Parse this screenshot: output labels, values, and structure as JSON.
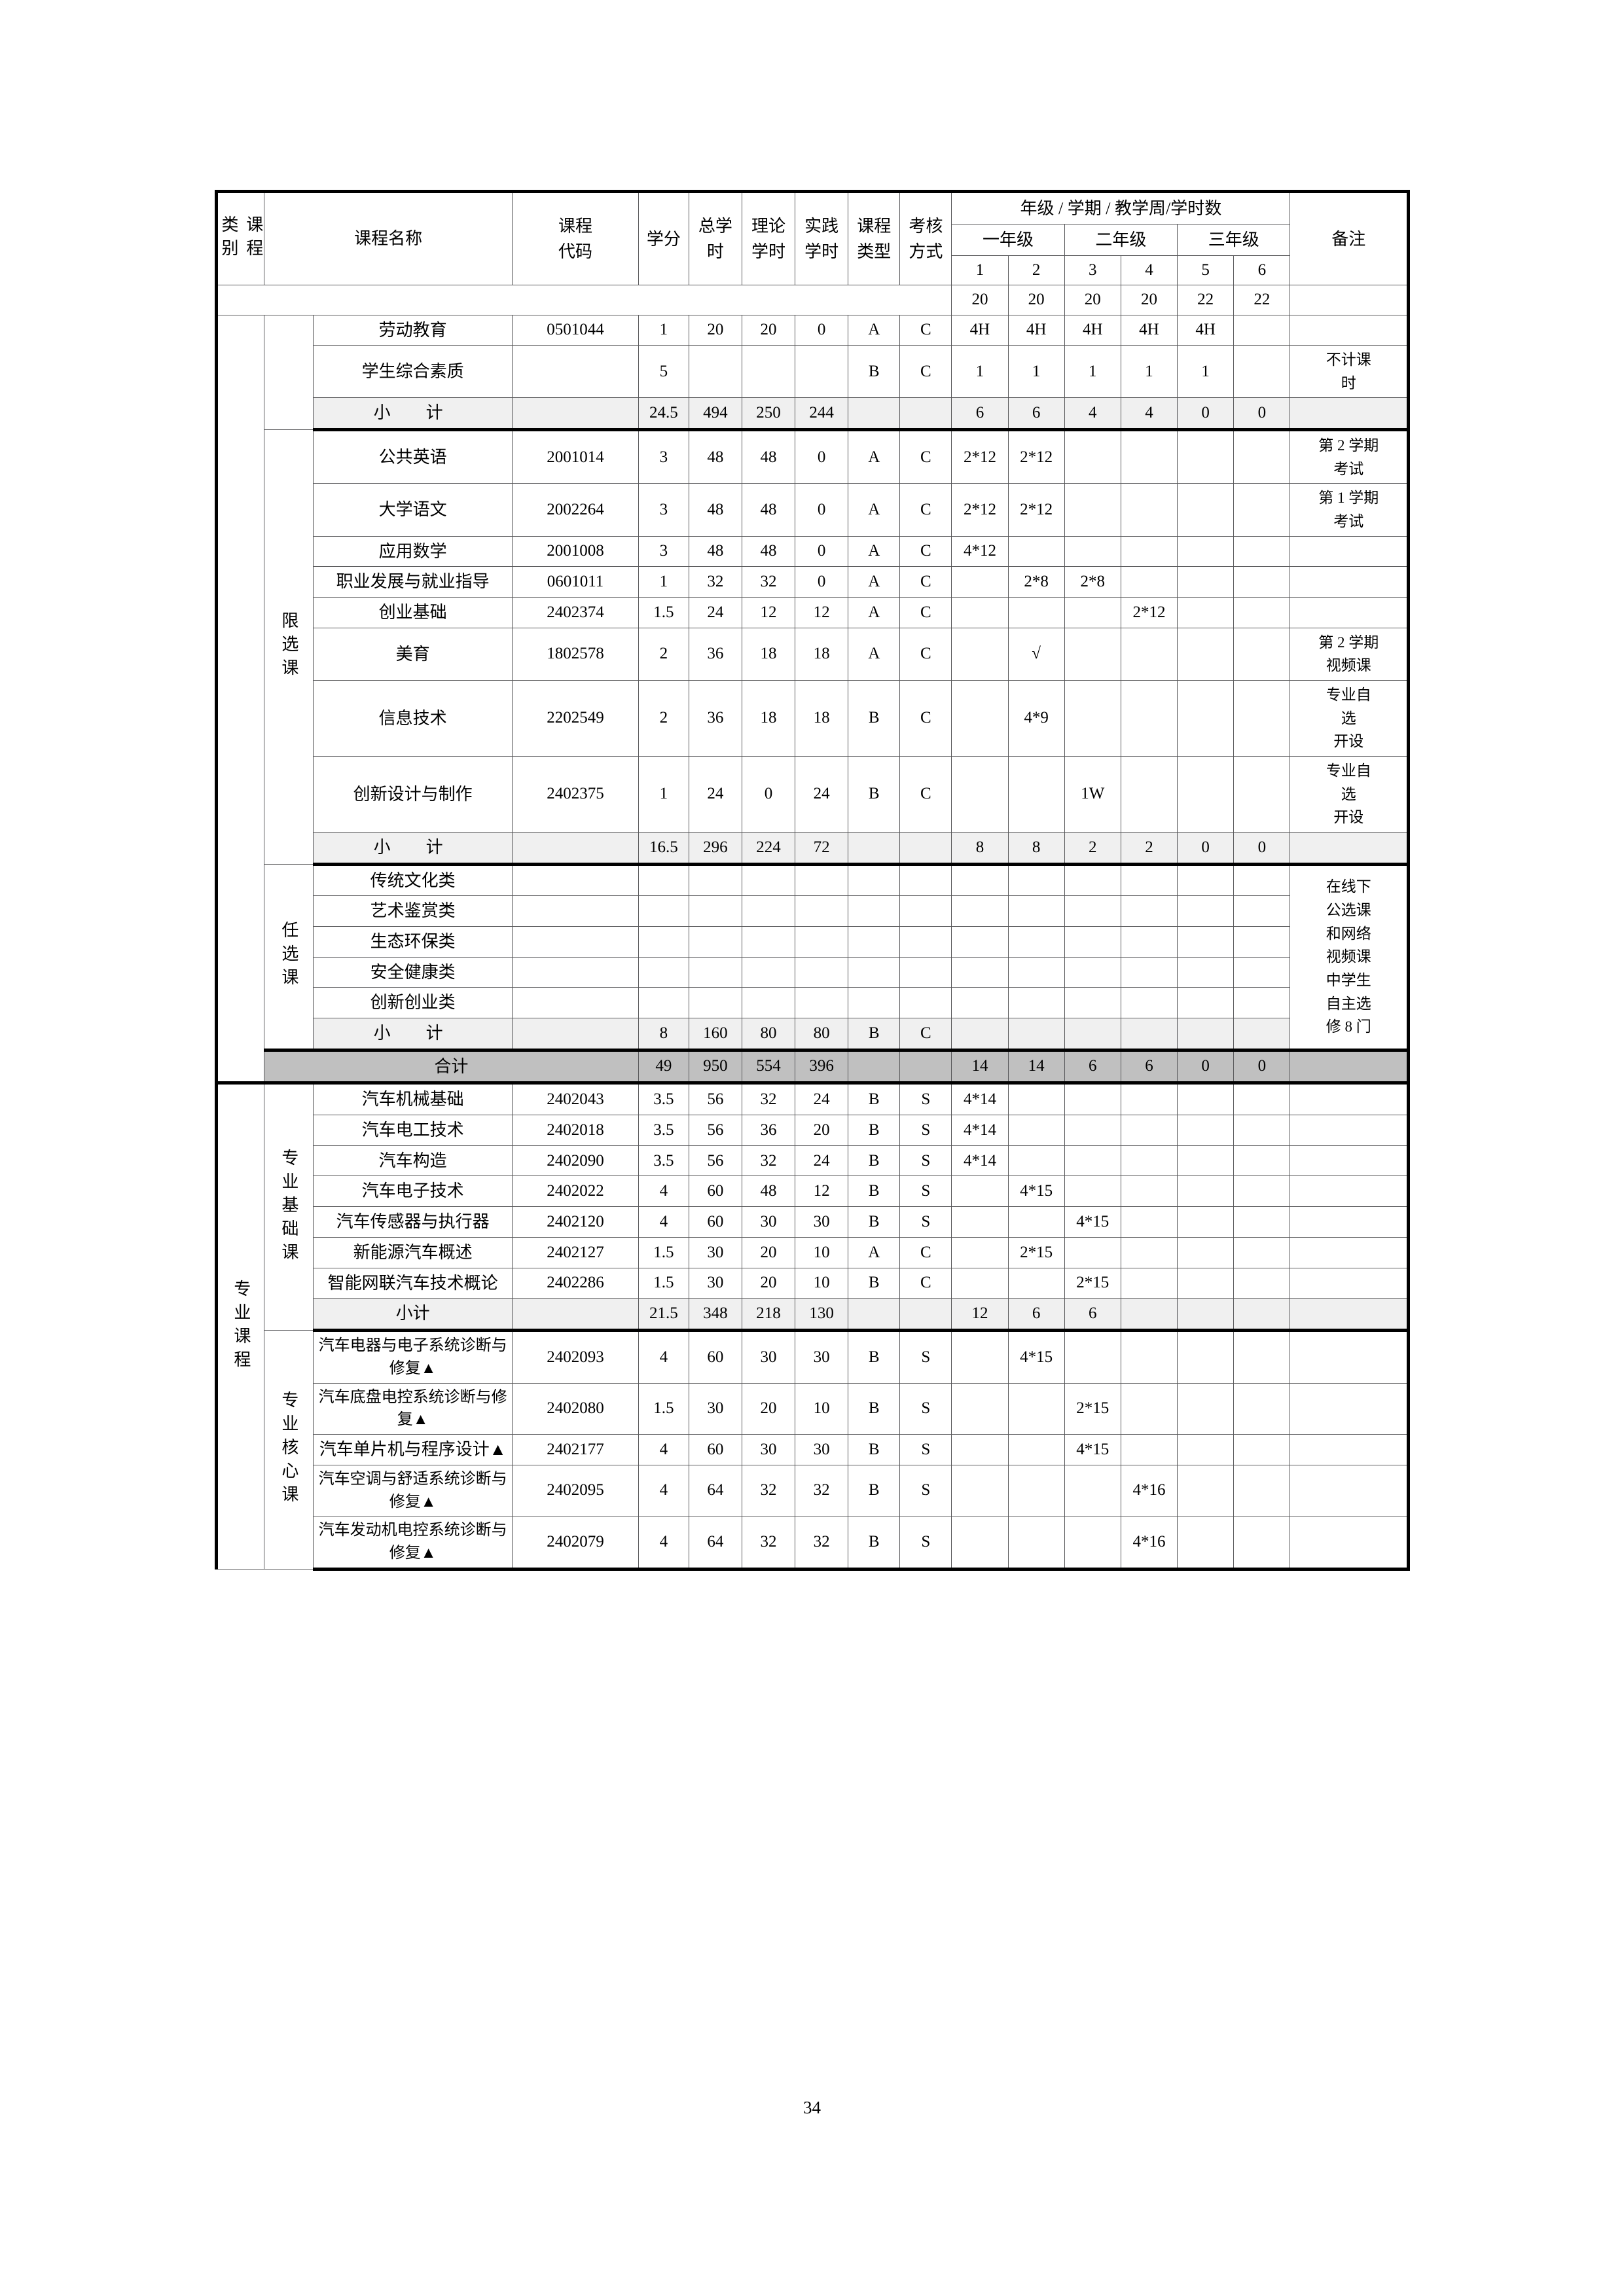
{
  "page": {
    "number": "34"
  },
  "table": {
    "headers": {
      "category": "课程\n类别",
      "course_name": "课程名称",
      "course_code": "课程\n代码",
      "credit": "学分",
      "total_hours": "总学\n时",
      "theory_hours": "理论\n学时",
      "practice_hours": "实践\n学时",
      "course_type": "课程\n类型",
      "exam_method": "考核\n方式",
      "semester_group": "年级 / 学期 / 教学周/学时数",
      "remark": "备注",
      "years": [
        "一年级",
        "二年级",
        "三年级"
      ],
      "semesters": [
        "1",
        "2",
        "3",
        "4",
        "5",
        "6"
      ],
      "weeks": [
        "20",
        "20",
        "20",
        "20",
        "22",
        "22"
      ]
    },
    "sections": [
      {
        "id": "public-required",
        "category_label": "",
        "rows": [
          {
            "name": "劳动教育",
            "code": "0501044",
            "credit": "1",
            "total": "20",
            "theory": "20",
            "practice": "0",
            "type": "A",
            "exam": "C",
            "sem": [
              "4H",
              "4H",
              "4H",
              "4H",
              "4H",
              ""
            ],
            "remark": ""
          },
          {
            "name": "学生综合素质",
            "code": "",
            "credit": "5",
            "total": "",
            "theory": "",
            "practice": "",
            "type": "B",
            "exam": "C",
            "sem": [
              "1",
              "1",
              "1",
              "1",
              "1",
              ""
            ],
            "remark": "不计课\n时"
          }
        ],
        "subtotal": {
          "label": "小　计",
          "code": "",
          "credit": "24.5",
          "total": "494",
          "theory": "250",
          "practice": "244",
          "type": "",
          "exam": "",
          "sem": [
            "6",
            "6",
            "4",
            "4",
            "0",
            "0"
          ],
          "remark": ""
        }
      },
      {
        "id": "restricted-elective",
        "category_label": "限选课",
        "rows": [
          {
            "name": "公共英语",
            "code": "2001014",
            "credit": "3",
            "total": "48",
            "theory": "48",
            "practice": "0",
            "type": "A",
            "exam": "C",
            "sem": [
              "2*12",
              "2*12",
              "",
              "",
              "",
              ""
            ],
            "remark": "第 2 学期\n考试"
          },
          {
            "name": "大学语文",
            "code": "2002264",
            "credit": "3",
            "total": "48",
            "theory": "48",
            "practice": "0",
            "type": "A",
            "exam": "C",
            "sem": [
              "2*12",
              "2*12",
              "",
              "",
              "",
              ""
            ],
            "remark": "第 1 学期\n考试"
          },
          {
            "name": "应用数学",
            "code": "2001008",
            "credit": "3",
            "total": "48",
            "theory": "48",
            "practice": "0",
            "type": "A",
            "exam": "C",
            "sem": [
              "4*12",
              "",
              "",
              "",
              "",
              ""
            ],
            "remark": ""
          },
          {
            "name": "职业发展与就业指导",
            "code": "0601011",
            "credit": "1",
            "total": "32",
            "theory": "32",
            "practice": "0",
            "type": "A",
            "exam": "C",
            "sem": [
              "",
              "2*8",
              "2*8",
              "",
              "",
              ""
            ],
            "remark": ""
          },
          {
            "name": "创业基础",
            "code": "2402374",
            "credit": "1.5",
            "total": "24",
            "theory": "12",
            "practice": "12",
            "type": "A",
            "exam": "C",
            "sem": [
              "",
              "",
              "",
              "2*12",
              "",
              ""
            ],
            "remark": ""
          },
          {
            "name": "美育",
            "code": "1802578",
            "credit": "2",
            "total": "36",
            "theory": "18",
            "practice": "18",
            "type": "A",
            "exam": "C",
            "sem": [
              "",
              "√",
              "",
              "",
              "",
              ""
            ],
            "remark": "第 2 学期\n视频课"
          },
          {
            "name": "信息技术",
            "code": "2202549",
            "credit": "2",
            "total": "36",
            "theory": "18",
            "practice": "18",
            "type": "B",
            "exam": "C",
            "sem": [
              "",
              "4*9",
              "",
              "",
              "",
              ""
            ],
            "remark": "专业自\n选\n开设"
          },
          {
            "name": "创新设计与制作",
            "code": "2402375",
            "credit": "1",
            "total": "24",
            "theory": "0",
            "practice": "24",
            "type": "B",
            "exam": "C",
            "sem": [
              "",
              "",
              "1W",
              "",
              "",
              ""
            ],
            "remark": "专业自\n选\n开设"
          }
        ],
        "subtotal": {
          "label": "小　计",
          "code": "",
          "credit": "16.5",
          "total": "296",
          "theory": "224",
          "practice": "72",
          "type": "",
          "exam": "",
          "sem": [
            "8",
            "8",
            "2",
            "2",
            "0",
            "0"
          ],
          "remark": ""
        }
      },
      {
        "id": "free-elective",
        "category_label": "任选课",
        "group_remark": "在线下\n公选课\n和网络\n视频课\n中学生\n自主选\n修 8 门",
        "rows": [
          {
            "name": "传统文化类",
            "code": "",
            "credit": "",
            "total": "",
            "theory": "",
            "practice": "",
            "type": "",
            "exam": "",
            "sem": [
              "",
              "",
              "",
              "",
              "",
              ""
            ]
          },
          {
            "name": "艺术鉴赏类",
            "code": "",
            "credit": "",
            "total": "",
            "theory": "",
            "practice": "",
            "type": "",
            "exam": "",
            "sem": [
              "",
              "",
              "",
              "",
              "",
              ""
            ]
          },
          {
            "name": "生态环保类",
            "code": "",
            "credit": "",
            "total": "",
            "theory": "",
            "practice": "",
            "type": "",
            "exam": "",
            "sem": [
              "",
              "",
              "",
              "",
              "",
              ""
            ]
          },
          {
            "name": "安全健康类",
            "code": "",
            "credit": "",
            "total": "",
            "theory": "",
            "practice": "",
            "type": "",
            "exam": "",
            "sem": [
              "",
              "",
              "",
              "",
              "",
              ""
            ]
          },
          {
            "name": "创新创业类",
            "code": "",
            "credit": "",
            "total": "",
            "theory": "",
            "practice": "",
            "type": "",
            "exam": "",
            "sem": [
              "",
              "",
              "",
              "",
              "",
              ""
            ]
          }
        ],
        "subtotal": {
          "label": "小　计",
          "code": "",
          "credit": "8",
          "total": "160",
          "theory": "80",
          "practice": "80",
          "type": "B",
          "exam": "C",
          "sem": [
            "",
            "",
            "",
            "",
            "",
            ""
          ],
          "remark": ""
        }
      }
    ],
    "grand_total": {
      "label": "合计",
      "code": "",
      "credit": "49",
      "total": "950",
      "theory": "554",
      "practice": "396",
      "type": "",
      "exam": "",
      "sem": [
        "14",
        "14",
        "6",
        "6",
        "0",
        "0"
      ],
      "remark": ""
    },
    "professional": {
      "category_label": "专业\n课程",
      "groups": [
        {
          "id": "professional-basic",
          "label": "专业基础课",
          "rows": [
            {
              "name": "汽车机械基础",
              "code": "2402043",
              "credit": "3.5",
              "total": "56",
              "theory": "32",
              "practice": "24",
              "type": "B",
              "exam": "S",
              "sem": [
                "4*14",
                "",
                "",
                "",
                "",
                ""
              ],
              "remark": ""
            },
            {
              "name": "汽车电工技术",
              "code": "2402018",
              "credit": "3.5",
              "total": "56",
              "theory": "36",
              "practice": "20",
              "type": "B",
              "exam": "S",
              "sem": [
                "4*14",
                "",
                "",
                "",
                "",
                ""
              ],
              "remark": ""
            },
            {
              "name": "汽车构造",
              "code": "2402090",
              "credit": "3.5",
              "total": "56",
              "theory": "32",
              "practice": "24",
              "type": "B",
              "exam": "S",
              "sem": [
                "4*14",
                "",
                "",
                "",
                "",
                ""
              ],
              "remark": ""
            },
            {
              "name": "汽车电子技术",
              "code": "2402022",
              "credit": "4",
              "total": "60",
              "theory": "48",
              "practice": "12",
              "type": "B",
              "exam": "S",
              "sem": [
                "",
                "4*15",
                "",
                "",
                "",
                ""
              ],
              "remark": ""
            },
            {
              "name": "汽车传感器与执行器",
              "code": "2402120",
              "credit": "4",
              "total": "60",
              "theory": "30",
              "practice": "30",
              "type": "B",
              "exam": "S",
              "sem": [
                "",
                "",
                "4*15",
                "",
                "",
                ""
              ],
              "remark": ""
            },
            {
              "name": "新能源汽车概述",
              "code": "2402127",
              "credit": "1.5",
              "total": "30",
              "theory": "20",
              "practice": "10",
              "type": "A",
              "exam": "C",
              "sem": [
                "",
                "2*15",
                "",
                "",
                "",
                ""
              ],
              "remark": ""
            },
            {
              "name": "智能网联汽车技术概论",
              "code": "2402286",
              "credit": "1.5",
              "total": "30",
              "theory": "20",
              "practice": "10",
              "type": "B",
              "exam": "C",
              "sem": [
                "",
                "",
                "2*15",
                "",
                "",
                ""
              ],
              "remark": ""
            }
          ],
          "subtotal": {
            "label": "小计",
            "code": "",
            "credit": "21.5",
            "total": "348",
            "theory": "218",
            "practice": "130",
            "type": "",
            "exam": "",
            "sem": [
              "12",
              "6",
              "6",
              "",
              "",
              ""
            ],
            "remark": ""
          }
        },
        {
          "id": "professional-core",
          "label": "专业核心课",
          "rows": [
            {
              "name": "汽车电器与电子系统诊断与修复▲",
              "code": "2402093",
              "credit": "4",
              "total": "60",
              "theory": "30",
              "practice": "30",
              "type": "B",
              "exam": "S",
              "sem": [
                "",
                "4*15",
                "",
                "",
                "",
                ""
              ],
              "remark": ""
            },
            {
              "name": "汽车底盘电控系统诊断与修复▲",
              "code": "2402080",
              "credit": "1.5",
              "total": "30",
              "theory": "20",
              "practice": "10",
              "type": "B",
              "exam": "S",
              "sem": [
                "",
                "",
                "2*15",
                "",
                "",
                ""
              ],
              "remark": ""
            },
            {
              "name": "汽车单片机与程序设计▲",
              "code": "2402177",
              "credit": "4",
              "total": "60",
              "theory": "30",
              "practice": "30",
              "type": "B",
              "exam": "S",
              "sem": [
                "",
                "",
                "4*15",
                "",
                "",
                ""
              ],
              "remark": ""
            },
            {
              "name": "汽车空调与舒适系统诊断与修复▲",
              "code": "2402095",
              "credit": "4",
              "total": "64",
              "theory": "32",
              "practice": "32",
              "type": "B",
              "exam": "S",
              "sem": [
                "",
                "",
                "",
                "4*16",
                "",
                ""
              ],
              "remark": ""
            },
            {
              "name": "汽车发动机电控系统诊断与修复▲",
              "code": "2402079",
              "credit": "4",
              "total": "64",
              "theory": "32",
              "practice": "32",
              "type": "B",
              "exam": "S",
              "sem": [
                "",
                "",
                "",
                "4*16",
                "",
                ""
              ],
              "remark": ""
            }
          ]
        }
      ]
    }
  }
}
